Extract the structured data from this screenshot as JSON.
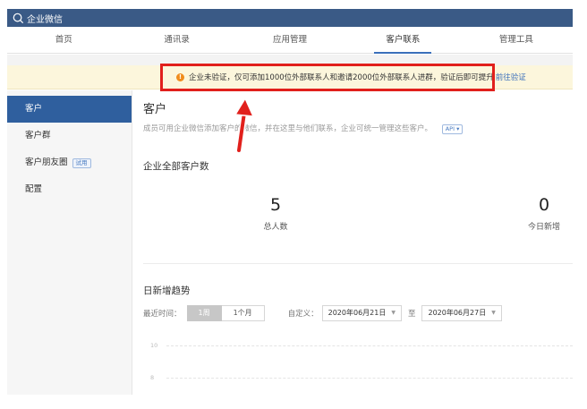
{
  "app": {
    "title": "企业微信"
  },
  "nav": {
    "items": [
      {
        "label": "首页"
      },
      {
        "label": "通讯录"
      },
      {
        "label": "应用管理"
      },
      {
        "label": "客户联系"
      },
      {
        "label": "管理工具"
      }
    ],
    "active_index": 3
  },
  "notice": {
    "text": "企业未验证，仅可添加1000位外部联系人和邀请2000位外部联系人进群，验证后即可提升",
    "link": "前往验证",
    "icon": "warning-icon"
  },
  "sidebar": {
    "items": [
      {
        "label": "客户"
      },
      {
        "label": "客户群"
      },
      {
        "label": "客户朋友圈",
        "badge": "试用"
      },
      {
        "label": "配置"
      }
    ]
  },
  "main": {
    "title": "客户",
    "desc": "成员可用企业微信添加客户的微信，并在这里与他们联系，企业可统一管理这些客户。",
    "api_badge": "API",
    "section_total": "企业全部客户数",
    "stats": [
      {
        "value": "5",
        "label": "总人数"
      },
      {
        "value": "0",
        "label": "今日新增"
      }
    ],
    "trend_title": "日新增趋势",
    "filter": {
      "recent_label": "最近时间：",
      "options": [
        "1周",
        "1个月"
      ],
      "selected": "1周",
      "custom_label": "自定义：",
      "start_date": "2020年06月21日",
      "to_label": "至",
      "end_date": "2020年06月27日"
    },
    "y_ticks": [
      "10",
      "8"
    ]
  },
  "colors": {
    "topbar": "#3a5a86",
    "accent": "#2f5f9e",
    "highlight": "#e1201c",
    "notice_bg": "#fcf6dc"
  }
}
